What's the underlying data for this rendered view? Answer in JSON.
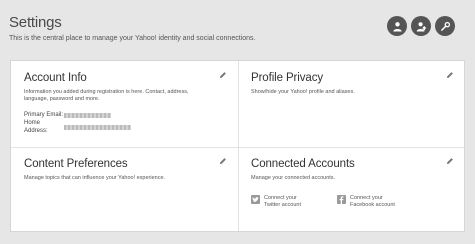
{
  "header": {
    "title": "Settings",
    "subtitle": "This is the central place to manage your Yahoo! identity and social connections."
  },
  "header_icons": [
    "user-icon",
    "user-settings-icon",
    "wrench-icon"
  ],
  "cards": {
    "account_info": {
      "title": "Account Info",
      "description": "Information you added during registration is here. Contact, address, language, password and more.",
      "primary_email_label": "Primary Email:",
      "home_address_label": "Home Address:"
    },
    "profile_privacy": {
      "title": "Profile Privacy",
      "description": "Show/hide your Yahoo! profile and aliases."
    },
    "content_preferences": {
      "title": "Content Preferences",
      "description": "Manage topics that can influence your Yahoo! experience."
    },
    "connected_accounts": {
      "title": "Connected Accounts",
      "description": "Manage your connected accounts.",
      "twitter_label": "Connect your Twitter account",
      "facebook_label": "Connect your Facebook account"
    }
  },
  "colors": {
    "background": "#e6e6e6",
    "card_bg": "#ffffff",
    "icon_button": "#555555"
  }
}
